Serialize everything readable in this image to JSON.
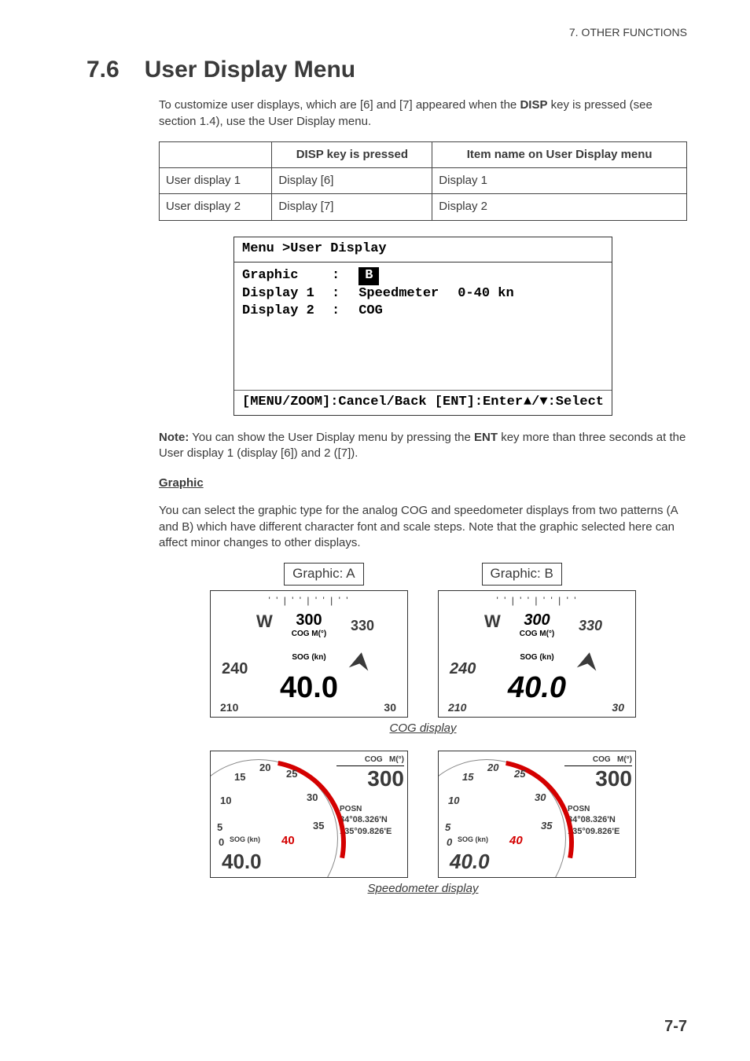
{
  "running_head": "7.  OTHER FUNCTIONS",
  "section": {
    "number": "7.6",
    "title": "User Display Menu"
  },
  "intro_a": "To customize user displays, which are [6] and [7] appeared when the ",
  "intro_key": "DISP",
  "intro_b": " key is pressed (see section 1.4), use the User Display menu.",
  "table": {
    "headers": [
      "",
      "DISP key is pressed",
      "Item name on User Display menu"
    ],
    "rows": [
      [
        "User display 1",
        "Display [6]",
        "Display 1"
      ],
      [
        "User display 2",
        "Display [7]",
        "Display 2"
      ]
    ]
  },
  "menushot": {
    "title": "Menu >User Display",
    "rows": [
      {
        "key": "Graphic",
        "val": "B",
        "hl": true,
        "extra": ""
      },
      {
        "key": "Display 1",
        "val": "Speedmeter",
        "hl": false,
        "extra": "0-40  kn"
      },
      {
        "key": "Display 2",
        "val": "COG",
        "hl": false,
        "extra": ""
      }
    ],
    "footer_left": "[MENU/ZOOM]:Cancel/Back  [ENT]:Enter",
    "footer_right": "▲/▼:Select"
  },
  "note_bold": "Note:",
  "note_a": " You can show the User Display menu by pressing the ",
  "note_key": "ENT",
  "note_b": " key more than three seconds at the User display 1 (display [6]) and 2 ([7]).",
  "graphic_head": "Graphic",
  "graphic_para": "You can select the graphic type for the analog COG and speedometer displays from two patterns (A and B) which have different character font and scale steps. Note that the graphic selected here can affect minor changes to other displays.",
  "graphic_a": "Graphic: A",
  "graphic_b": "Graphic: B",
  "cog_caption": "COG display",
  "spd_caption": "Speedometer display",
  "cog_gauge": {
    "heading_main": "300",
    "heading_330": "330",
    "heading_240": "240",
    "heading_210": "210",
    "heading_30": "30",
    "heading_w": "W",
    "cog_label": "COG M(°)",
    "sog_label": "SOG (kn)",
    "sog_value": "40.0",
    "needle": "⮝"
  },
  "spd_gauge": {
    "ticks": {
      "t0": "0",
      "t5": "5",
      "t10": "10",
      "t15": "15",
      "t20": "20",
      "t25": "25",
      "t30": "30",
      "t35": "35"
    },
    "sog_label": "SOG (kn)",
    "sog_value": "40.0",
    "needle40": "40",
    "cog_lbl": "COG",
    "cog_unit": "M(°)",
    "cog_val": "300",
    "posn_lbl": "POSN",
    "lat": "34°08.326'N",
    "lon": "135°09.826'E"
  },
  "page_num": "7-7"
}
